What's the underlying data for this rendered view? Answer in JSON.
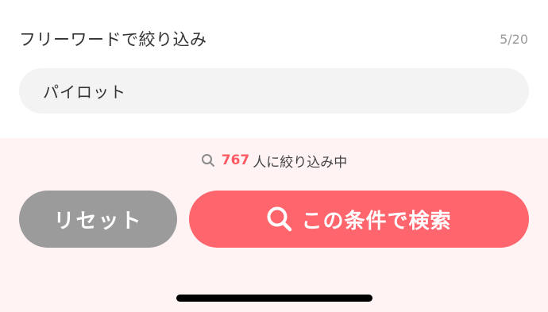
{
  "filter": {
    "label": "フリーワードで絞り込み",
    "char_count": "5/20",
    "input_value": "パイロット"
  },
  "results": {
    "count": "767",
    "suffix": "人に絞り込み中"
  },
  "actions": {
    "reset_label": "リセット",
    "search_label": "この条件で検索"
  },
  "icons": {
    "small_search": "search-icon",
    "button_search": "search-icon"
  },
  "colors": {
    "accent": "#ff656d",
    "count_accent": "#ff5a64",
    "reset_gray": "#9b9b9b",
    "panel_pink": "#fff3f3",
    "input_bg": "#f3f3f3"
  }
}
